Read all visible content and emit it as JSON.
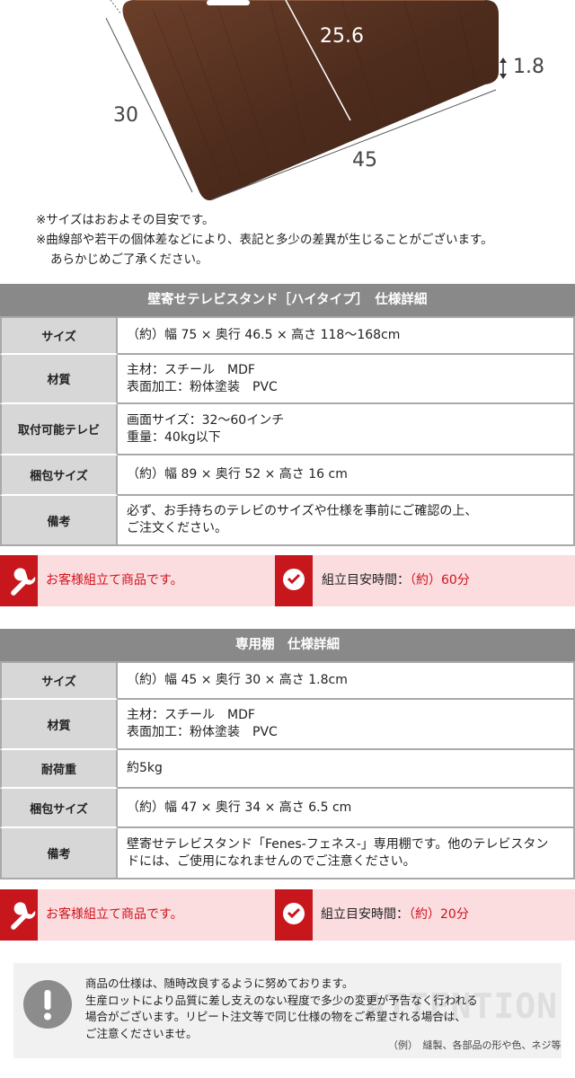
{
  "diagram": {
    "dim_width": "45",
    "dim_depth": "30",
    "dim_height": "25.6",
    "dim_thickness": "1.8",
    "board_color": "#5a3423"
  },
  "notes": {
    "line1": "※サイズはおおよその目安です。",
    "line2": "※曲線部や若干の個体差などにより、表記と多少の差異が生じることがございます。",
    "line3": "あらかじめご了承ください。"
  },
  "spec1": {
    "title": "壁寄せテレビスタンド［ハイタイプ］　仕様詳細",
    "rows": [
      {
        "label": "サイズ",
        "lines": [
          "（約）幅 75 × 奥行 46.5 × 高さ 118〜168cm"
        ]
      },
      {
        "label": "材質",
        "lines": [
          "主材：スチール　MDF",
          "表面加工：粉体塗装　PVC"
        ]
      },
      {
        "label": "取付可能テレビ",
        "lines": [
          "画面サイズ：32〜60インチ",
          "重量：40kg以下"
        ]
      },
      {
        "label": "梱包サイズ",
        "lines": [
          "（約）幅 89 × 奥行 52 × 高さ 16 cm"
        ]
      },
      {
        "label": "備考",
        "lines": [
          "必ず、お手持ちのテレビのサイズや仕様を事前にご確認の上、",
          "ご注文ください。"
        ]
      }
    ],
    "assembly_text": "お客様組立て商品です。",
    "time_label": "組立目安時間：",
    "time_value": "（約）60分"
  },
  "spec2": {
    "title": "専用棚　仕様詳細",
    "rows": [
      {
        "label": "サイズ",
        "lines": [
          "（約）幅 45 × 奥行 30 × 高さ 1.8cm"
        ]
      },
      {
        "label": "材質",
        "lines": [
          "主材：スチール　MDF",
          "表面加工：粉体塗装　PVC"
        ]
      },
      {
        "label": "耐荷重",
        "lines": [
          "約5kg"
        ]
      },
      {
        "label": "梱包サイズ",
        "lines": [
          "（約）幅 47 × 奥行 34 × 高さ 6.5 cm"
        ]
      },
      {
        "label": "備考",
        "lines": [
          "壁寄せテレビスタンド「Fenes-フェネス-」専用棚です。他のテレビスタン",
          "ドには、ご使用になれませんのでご注意ください。"
        ]
      }
    ],
    "assembly_text": "お客様組立て商品です。",
    "time_label": "組立目安時間：",
    "time_value": "（約）20分"
  },
  "notice": {
    "line1": "商品の仕様は、随時改良するように努めております。",
    "line2": "生産ロットにより品質に差し支えのない程度で多少の変更が予告なく行われる",
    "line3": "場合がございます。リピート注文等で同じ仕様の物をご希望される場合は、",
    "line4": "ご注意くださいませ。",
    "watermark": "ATTENTION",
    "example": "（例）　縫製、各部品の形や色、ネジ等"
  },
  "colors": {
    "header_gray": "#898989",
    "label_gray": "#d7d7d7",
    "accent_red": "#c8161d",
    "pink_bg": "#fbdde0"
  }
}
